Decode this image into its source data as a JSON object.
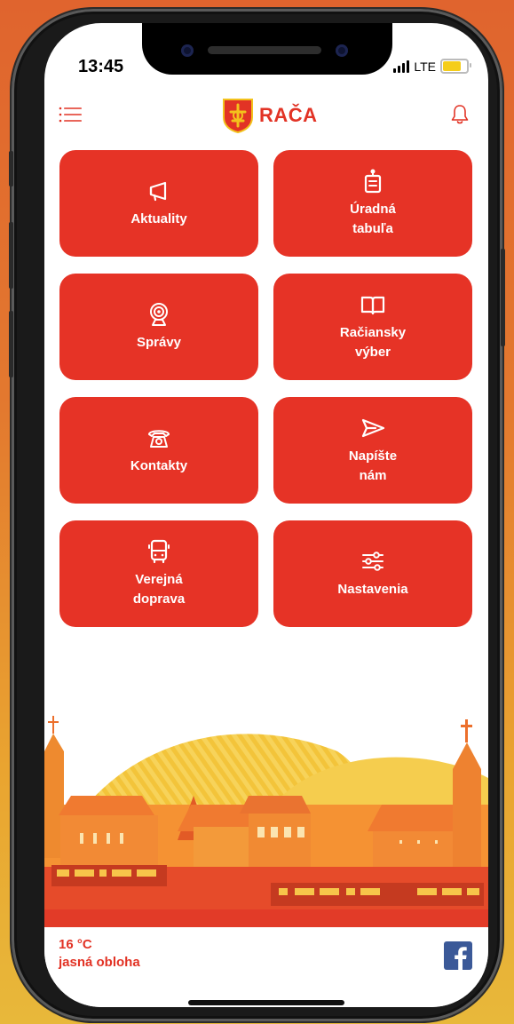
{
  "status_bar": {
    "time": "13:45",
    "network": "LTE"
  },
  "header": {
    "brand": "RAČA"
  },
  "tiles": [
    {
      "label": "Aktuality",
      "icon": "megaphone-icon"
    },
    {
      "label": "Úradná\ntabuľa",
      "icon": "notice-board-icon"
    },
    {
      "label": "Správy",
      "icon": "broadcast-icon"
    },
    {
      "label": "Račiansky\nvýber",
      "icon": "book-icon"
    },
    {
      "label": "Kontakty",
      "icon": "phone-icon"
    },
    {
      "label": "Napíšte\nnám",
      "icon": "send-icon"
    },
    {
      "label": "Verejná\ndoprava",
      "icon": "bus-icon"
    },
    {
      "label": "Nastavenia",
      "icon": "sliders-icon"
    }
  ],
  "weather": {
    "temperature": "16 °C",
    "description": "jasná obloha"
  },
  "colors": {
    "accent": "#e63326",
    "brand_text": "#e23325",
    "facebook": "#3b5998"
  }
}
